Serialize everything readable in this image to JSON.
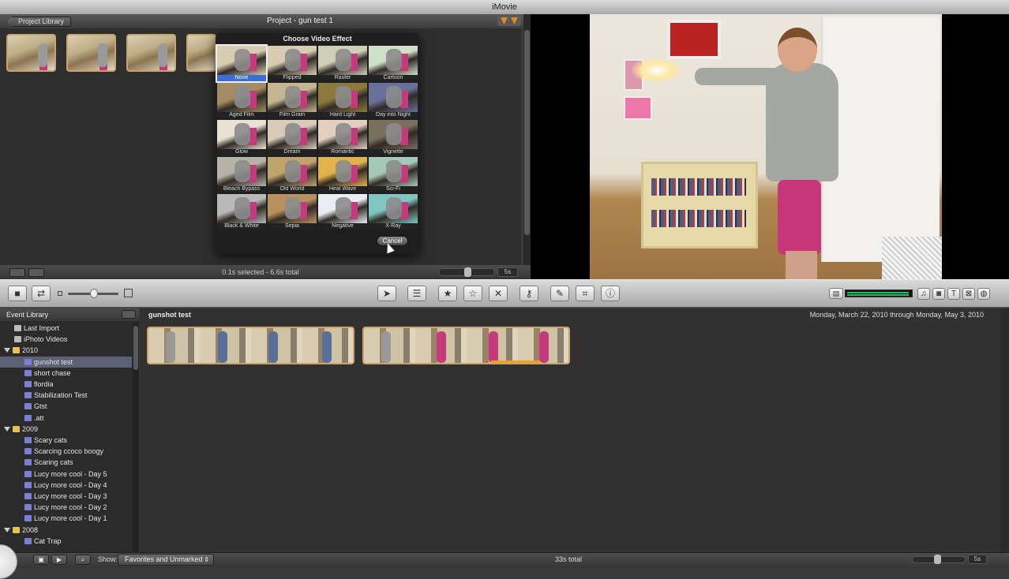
{
  "window": {
    "title": "iMovie"
  },
  "project": {
    "library_button": "Project Library",
    "title": "Project - gun test 1",
    "status": "0.1s selected - 6.6s total",
    "duration": "5s"
  },
  "effect_dialog": {
    "title": "Choose Video Effect",
    "cancel_label": "Cancel",
    "selected": "None",
    "effects": [
      {
        "name": "None",
        "tint": "#d8cdb2"
      },
      {
        "name": "Flipped",
        "tint": "#d8cdb2"
      },
      {
        "name": "Raster",
        "tint": "#cfcfb5"
      },
      {
        "name": "Cartoon",
        "tint": "#cfe0c8"
      },
      {
        "name": "Aged Film",
        "tint": "#a48b63"
      },
      {
        "name": "Film Grain",
        "tint": "#c4b593"
      },
      {
        "name": "Hard Light",
        "tint": "#8c7a3c"
      },
      {
        "name": "Day into Night",
        "tint": "#6b6f9b"
      },
      {
        "name": "Glow",
        "tint": "#e8e2d4"
      },
      {
        "name": "Dream",
        "tint": "#d8cbb8"
      },
      {
        "name": "Romantic",
        "tint": "#e2cfc0"
      },
      {
        "name": "Vignette",
        "tint": "#7a6e5c"
      },
      {
        "name": "Bleach Bypass",
        "tint": "#b7b2a8"
      },
      {
        "name": "Old World",
        "tint": "#bfa46e"
      },
      {
        "name": "Heat Wave",
        "tint": "#e0b44a"
      },
      {
        "name": "Sci-Fi",
        "tint": "#a6c8b8"
      },
      {
        "name": "Black & White",
        "tint": "#b9b9b9"
      },
      {
        "name": "Sepia",
        "tint": "#b8925e"
      },
      {
        "name": "Negative",
        "tint": "#e8eef2"
      },
      {
        "name": "X-Ray",
        "tint": "#7fc5c2"
      }
    ]
  },
  "toolbar": {
    "icons": [
      "camera-icon",
      "swap-icon",
      "arrow-icon",
      "hand-icon",
      "star-icon",
      "outline-star-icon",
      "reject-icon",
      "key-icon",
      "dropper-icon",
      "crop-icon",
      "info-icon",
      "music-icon",
      "photo-icon",
      "title-icon",
      "transition-icon",
      "map-icon"
    ]
  },
  "event_library": {
    "title": "Event Library",
    "items": [
      {
        "label": "Last Import",
        "type": "lib",
        "indent": 1
      },
      {
        "label": "iPhoto Videos",
        "type": "lib",
        "indent": 1
      },
      {
        "label": "2010",
        "type": "folder",
        "indent": 0
      },
      {
        "label": "gunshot test",
        "type": "event",
        "indent": 2,
        "selected": true
      },
      {
        "label": "short chase",
        "type": "event",
        "indent": 2
      },
      {
        "label": "flordia",
        "type": "event",
        "indent": 2
      },
      {
        "label": "Stabilization Test",
        "type": "event",
        "indent": 2
      },
      {
        "label": "Gtst",
        "type": "event",
        "indent": 2
      },
      {
        "label": ".att",
        "type": "event",
        "indent": 2
      },
      {
        "label": "2009",
        "type": "folder",
        "indent": 0
      },
      {
        "label": "Scary cats",
        "type": "event",
        "indent": 2
      },
      {
        "label": "Scarcing ccoco boogy",
        "type": "event",
        "indent": 2
      },
      {
        "label": "Scaring cats",
        "type": "event",
        "indent": 2
      },
      {
        "label": "Lucy more cool - Day 5",
        "type": "event",
        "indent": 2
      },
      {
        "label": "Lucy more cool - Day 4",
        "type": "event",
        "indent": 2
      },
      {
        "label": "Lucy more cool - Day 3",
        "type": "event",
        "indent": 2
      },
      {
        "label": "Lucy more cool - Day 2",
        "type": "event",
        "indent": 2
      },
      {
        "label": "Lucy more cool - Day 1",
        "type": "event",
        "indent": 2
      },
      {
        "label": "2008",
        "type": "folder",
        "indent": 0
      },
      {
        "label": "Cat Trap",
        "type": "event",
        "indent": 2
      }
    ]
  },
  "event_view": {
    "title": "gunshot test",
    "date_range": "Monday, March 22, 2010 through Monday, May 3, 2010"
  },
  "bottom": {
    "show_label": "Show:",
    "show_value": "Favorites and Unmarked",
    "total": "33s total",
    "duration": "5s"
  }
}
